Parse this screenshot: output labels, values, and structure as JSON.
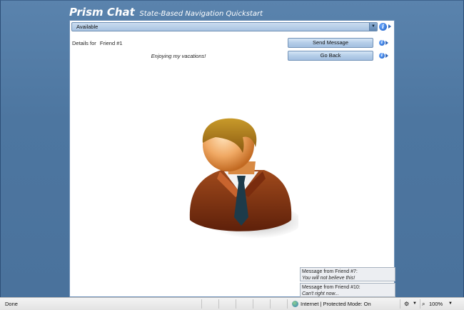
{
  "app": {
    "title": "Prism Chat",
    "subtitle": "State-Based Navigation Quickstart"
  },
  "status_select": {
    "value": "Available"
  },
  "details": {
    "label": "Details for",
    "friend": "Friend #1",
    "status_message": "Enjoying my vacations!"
  },
  "buttons": {
    "send_message": "Send Message",
    "go_back": "Go Back"
  },
  "messages": [
    {
      "from": "Message from Friend #7:",
      "body": "You will not believe this!"
    },
    {
      "from": "Message from Friend #10:",
      "body": "Can't right now..."
    }
  ],
  "status_bar": {
    "status": "Done",
    "zone": "Internet | Protected Mode: On",
    "zoom": "100%"
  },
  "icons": {
    "info": "info-icon",
    "select_arrow": "chevron-down-icon",
    "globe": "globe-icon",
    "zoom": "magnifier-icon"
  },
  "colors": {
    "background": "#4f78a3",
    "button": "#b4cde8",
    "info": "#1d5fc4"
  }
}
